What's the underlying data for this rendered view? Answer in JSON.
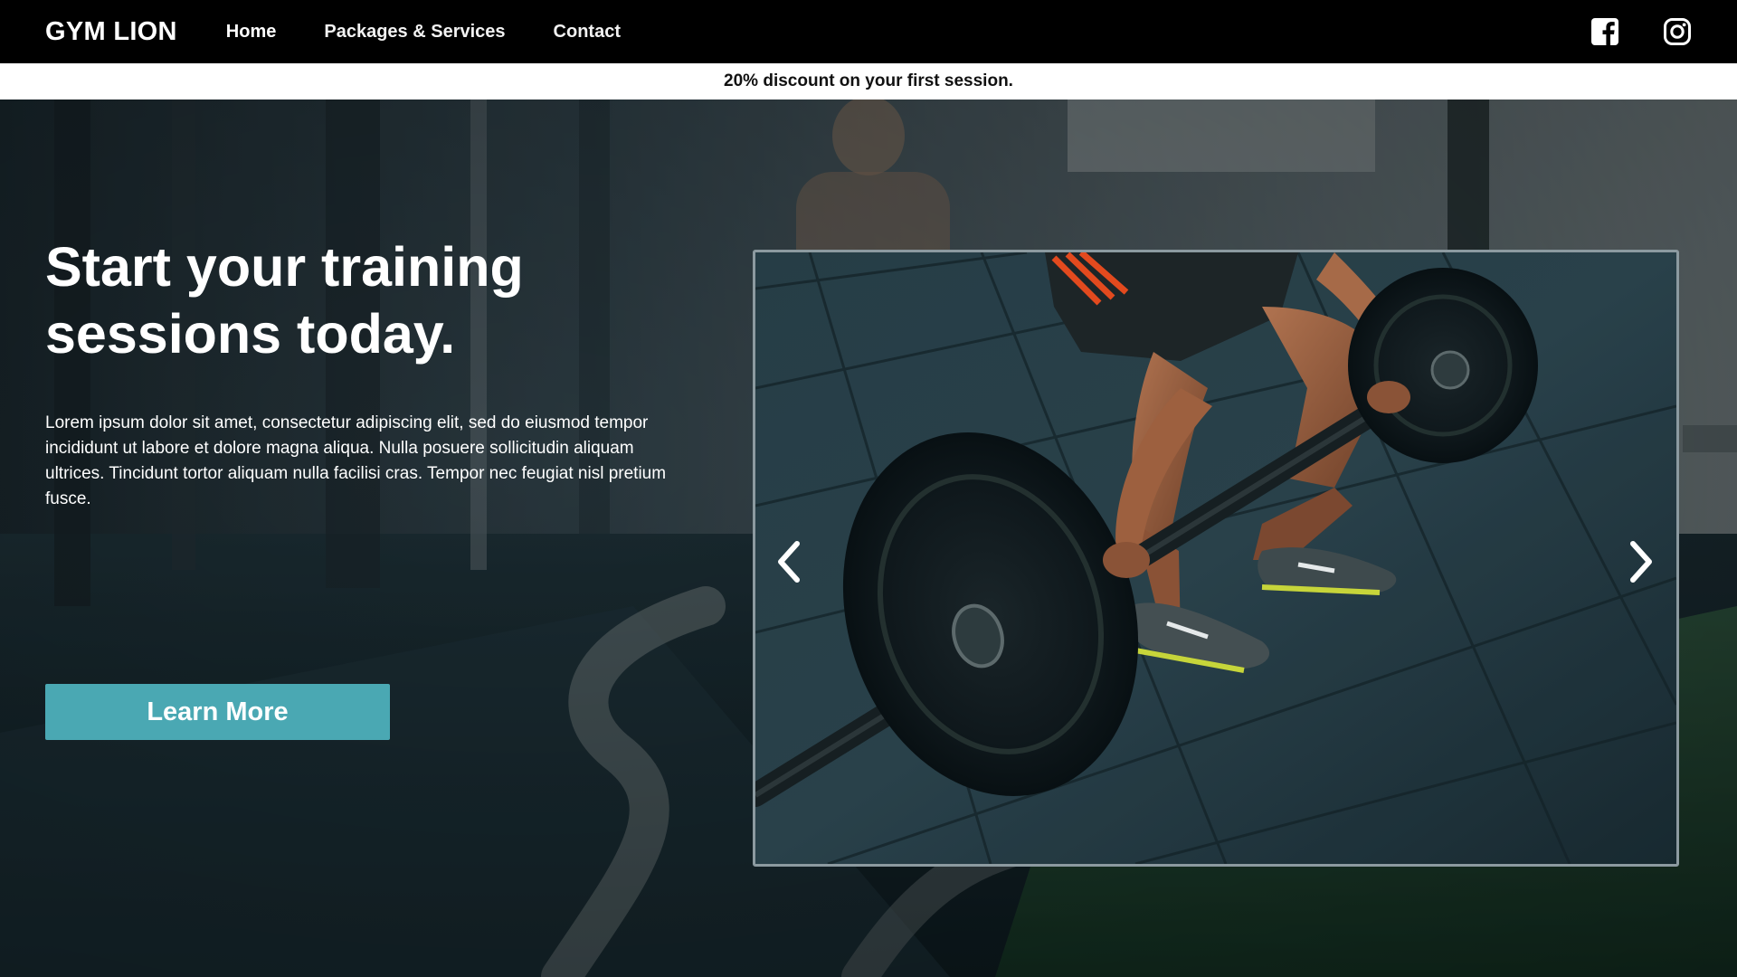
{
  "nav": {
    "brand": "GYM LION",
    "links": [
      "Home",
      "Packages & Services",
      "Contact"
    ],
    "social_icons": [
      "facebook-icon",
      "instagram-icon"
    ]
  },
  "promo": {
    "text": "20% discount on your first session."
  },
  "hero": {
    "title": "Start your training sessions today.",
    "body": "Lorem ipsum dolor sit amet, consectetur adipiscing elit, sed do eiusmod tempor incididunt ut labore et dolore magna aliqua. Nulla posuere sollicitudin aliquam ultrices. Tincidunt tortor aliquam nulla facilisi cras. Tempor nec feugiat nisl pretium fusce.",
    "cta_label": "Learn More"
  },
  "carousel": {
    "prev_icon": "chevron-left-icon",
    "next_icon": "chevron-right-icon"
  },
  "colors": {
    "navbar": "#000000",
    "promo_bg": "#ffffff",
    "accent": "#4aa8b3"
  }
}
